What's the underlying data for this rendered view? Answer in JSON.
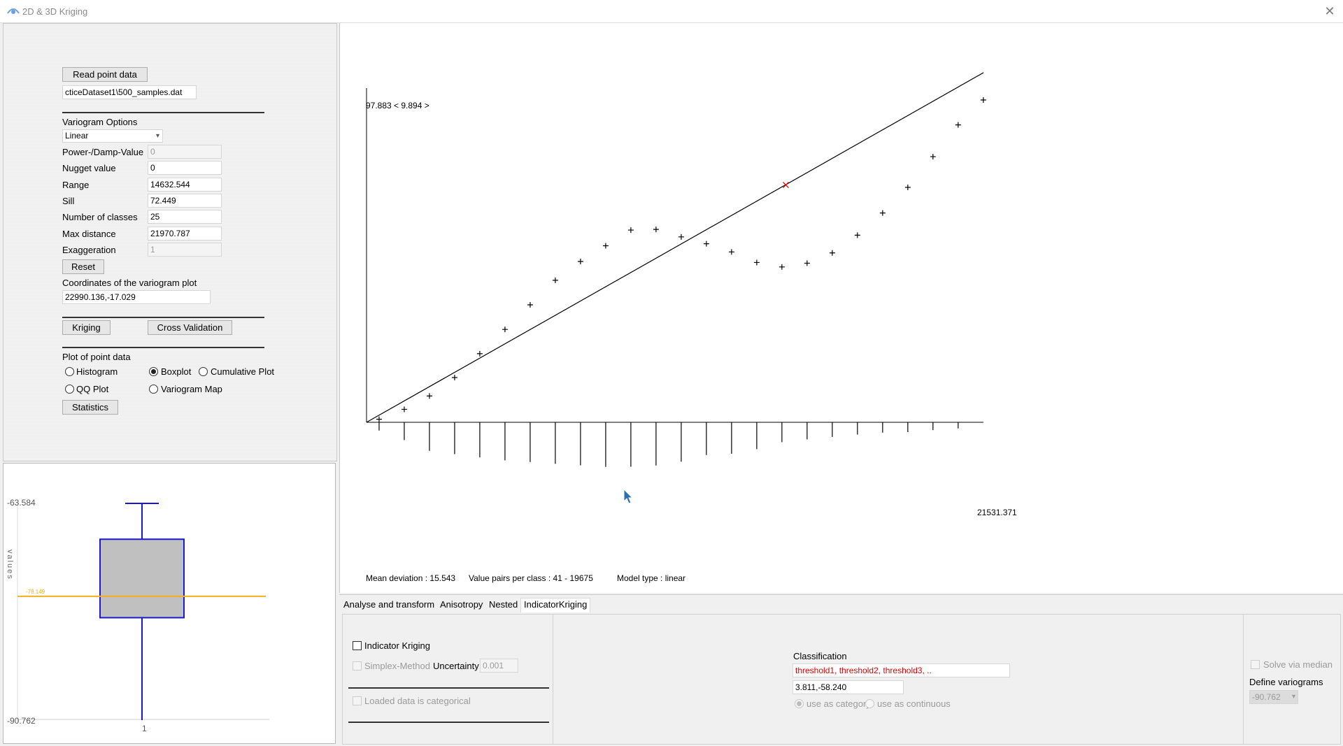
{
  "window": {
    "title": "2D & 3D Kriging",
    "close_symbol": "✕"
  },
  "left_panel": {
    "read_button": "Read point data",
    "file_path": "cticeDataset1\\500_samples.dat",
    "variogram_options_label": "Variogram Options",
    "model_select": "Linear",
    "params": [
      {
        "label": "Power-/Damp-Value",
        "value": "0",
        "disabled": true
      },
      {
        "label": "Nugget value",
        "value": "0",
        "disabled": false
      },
      {
        "label": "Range",
        "value": "14632.544",
        "disabled": false
      },
      {
        "label": "Sill",
        "value": "72.449",
        "disabled": false
      },
      {
        "label": "Number of classes",
        "value": "25",
        "disabled": false
      },
      {
        "label": "Max distance",
        "value": "21970.787",
        "disabled": false
      },
      {
        "label": "Exaggeration",
        "value": "1",
        "disabled": true
      }
    ],
    "reset_button": "Reset",
    "coords_label": "Coordinates of the variogram plot",
    "coords_value": "22990.136,-17.029",
    "kriging_button": "Kriging",
    "cross_validation_button": "Cross Validation",
    "plot_label": "Plot of point data",
    "plot_options": {
      "histogram": "Histogram",
      "boxplot": "Boxplot",
      "cumulative": "Cumulative Plot",
      "qq": "QQ Plot",
      "variogram_map": "Variogram Map"
    },
    "selected_plot": "Boxplot",
    "statistics_button": "Statistics"
  },
  "boxplot": {
    "y_max_label": "-63.584",
    "y_min_label": "-90.762",
    "axis_label": "values",
    "x_label": "1",
    "median_label": "-78.149",
    "stats": {
      "ymin": -90.762,
      "ymax": -63.584,
      "whisker_low": -90.762,
      "q1": -81.5,
      "median": -78.149,
      "q3": -69.2,
      "whisker_high": -63.584,
      "reference_line": -78.149
    },
    "colors": {
      "box_fill": "#c0c0c0",
      "box_stroke": "#1a1acc",
      "median_line": "#f2b01e"
    }
  },
  "chart": {
    "top_label": "97.883 < 9.894 >",
    "x_max_label": "21531.371",
    "status": {
      "mean_deviation": "Mean deviation : 15.543",
      "value_pairs": "Value pairs per class : 41 - 19675",
      "model_type": "Model type : linear"
    }
  },
  "chart_data": {
    "type": "scatter",
    "title": "",
    "xlabel": "",
    "ylabel": "",
    "xlim": [
      0,
      21531.371
    ],
    "ylim": [
      0,
      97.883
    ],
    "grid": false,
    "points": [
      {
        "x": 439,
        "y": 0.9
      },
      {
        "x": 1317,
        "y": 3.8
      },
      {
        "x": 2196,
        "y": 7.7
      },
      {
        "x": 3075,
        "y": 13.1
      },
      {
        "x": 3953,
        "y": 20.1
      },
      {
        "x": 4832,
        "y": 27.2
      },
      {
        "x": 5711,
        "y": 34.4
      },
      {
        "x": 6589,
        "y": 41.6
      },
      {
        "x": 7468,
        "y": 47.1
      },
      {
        "x": 8347,
        "y": 51.7
      },
      {
        "x": 9225,
        "y": 56.3
      },
      {
        "x": 10104,
        "y": 56.5
      },
      {
        "x": 10983,
        "y": 54.3
      },
      {
        "x": 11861,
        "y": 52.3
      },
      {
        "x": 12740,
        "y": 49.9
      },
      {
        "x": 13619,
        "y": 46.8
      },
      {
        "x": 14497,
        "y": 45.5
      },
      {
        "x": 15376,
        "y": 46.6
      },
      {
        "x": 16255,
        "y": 49.6
      },
      {
        "x": 17133,
        "y": 54.8
      },
      {
        "x": 18012,
        "y": 61.3
      },
      {
        "x": 18891,
        "y": 68.8
      },
      {
        "x": 19769,
        "y": 77.8
      },
      {
        "x": 20648,
        "y": 87.1
      },
      {
        "x": 21527,
        "y": 94.4
      }
    ],
    "model_line": [
      [
        0,
        0
      ],
      [
        21531.371,
        102.4
      ]
    ],
    "marker": {
      "x": 14632.544,
      "y": 69.5
    },
    "tick_heights": [
      5.9,
      12.7,
      20.4,
      22.8,
      25.1,
      27.2,
      28.4,
      29.7,
      30.8,
      31.9,
      31.8,
      30.9,
      28.2,
      23.4,
      22.5,
      19.2,
      14.2,
      12.2,
      10.5,
      8.8,
      7.4,
      7.0,
      5.6,
      4.4,
      0.0
    ],
    "colors": {
      "points": "#000000",
      "line": "#000000",
      "marker": "#e00000"
    }
  },
  "bottom": {
    "tabs": [
      "Analyse and transform",
      "Anisotropy",
      "Nested",
      "IndicatorKriging"
    ],
    "active_tab": "IndicatorKriging",
    "indicator_kriging": "Indicator Kriging",
    "simplex_method": "Simplex-Method",
    "uncertainty_label": "Uncertainty",
    "uncertainty_value": "0.001",
    "loaded_categorical": "Loaded data is categorical",
    "classification_label": "Classification",
    "thresholds_value": "threshold1, threshold2, threshold3, ..",
    "class_value": "3.811,-58.240",
    "use_category": "use as category",
    "use_continuous": "use as continuous",
    "solve_median": "Solve via median",
    "define_variograms": "Define variograms",
    "variogram_select": "-90.762"
  }
}
